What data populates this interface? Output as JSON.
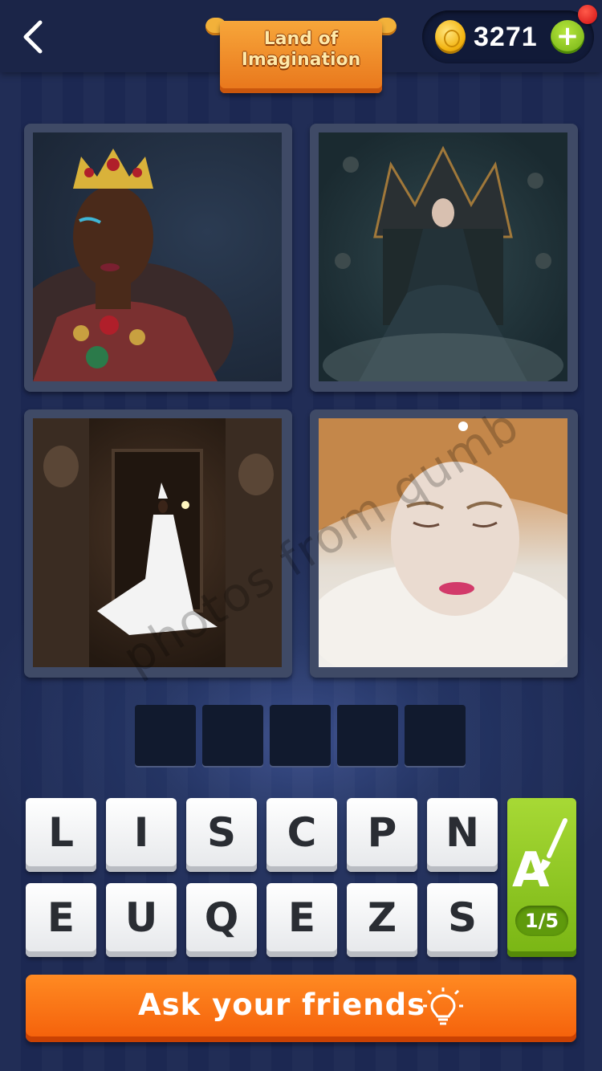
{
  "header": {
    "banner_title": "Land of\nImagination",
    "coins": "3271",
    "plus_label": "+"
  },
  "puzzle": {
    "photos": [
      {
        "name": "crowned-woman"
      },
      {
        "name": "dark-queen-on-throne"
      },
      {
        "name": "woman-in-white-gown-temple"
      },
      {
        "name": "woman-with-ruff-collar"
      }
    ],
    "watermark": "photos from qumb",
    "answer_slots": 5
  },
  "keyboard": {
    "row1": [
      "L",
      "I",
      "S",
      "C",
      "P",
      "N"
    ],
    "row2": [
      "E",
      "U",
      "Q",
      "E",
      "Z",
      "S"
    ]
  },
  "hint": {
    "icon": "paintbrush-letter-icon",
    "count": "1/5"
  },
  "ask_button": {
    "label": "Ask your friends",
    "icon": "lightbulb-icon"
  },
  "colors": {
    "background": "#1c2852",
    "accent_orange": "#f45f0a",
    "hint_green": "#79b514",
    "coin_gold": "#f3b411"
  }
}
